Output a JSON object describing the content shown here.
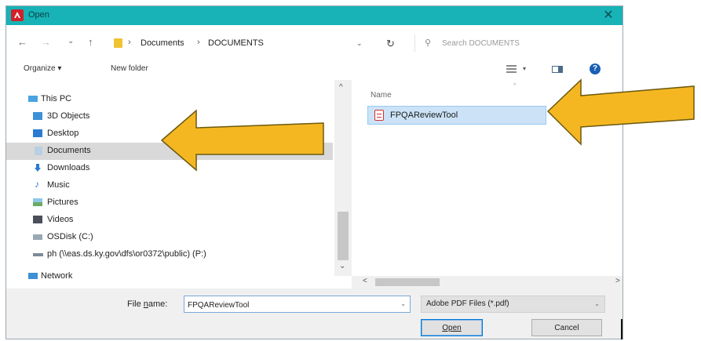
{
  "colors": {
    "titlebar": "#17b3b7",
    "accent": "#d0212a",
    "arrow_fill": "#f5b721",
    "arrow_stroke": "#6b5a10",
    "selection": "#cce3f7"
  },
  "window": {
    "title": "Open",
    "app_icon": "acrobat-icon",
    "close_glyph": "✕"
  },
  "navbar": {
    "back_glyph": "←",
    "forward_glyph": "→",
    "recent_glyph": "⌄",
    "up_glyph": "↑",
    "breadcrumb": [
      "Documents",
      "DOCUMENTS"
    ],
    "breadcrumb_prefix": "›",
    "breadcrumb_sep": "›",
    "dropdown_glyph": "⌄",
    "refresh_glyph": "↻",
    "search_placeholder": "Search DOCUMENTS"
  },
  "toolbar": {
    "organize_label": "Organize ▾",
    "new_folder_label": "New folder",
    "help_glyph": "?"
  },
  "sidebar": {
    "items": [
      {
        "label": "This PC",
        "icon": "this-pc-icon"
      },
      {
        "label": "3D Objects",
        "icon": "3d-objects-icon"
      },
      {
        "label": "Desktop",
        "icon": "desktop-icon"
      },
      {
        "label": "Documents",
        "icon": "documents-icon",
        "selected": true
      },
      {
        "label": "Downloads",
        "icon": "downloads-icon"
      },
      {
        "label": "Music",
        "icon": "music-icon"
      },
      {
        "label": "Pictures",
        "icon": "pictures-icon"
      },
      {
        "label": "Videos",
        "icon": "videos-icon"
      },
      {
        "label": "OSDisk (C:)",
        "icon": "drive-icon"
      },
      {
        "label": "ph (\\\\eas.ds.ky.gov\\dfs\\or0372\\public) (P:)",
        "icon": "network-drive-icon"
      },
      {
        "label": "Network",
        "icon": "network-icon"
      }
    ],
    "scroll_up_glyph": "^",
    "scroll_down_glyph": "⌄"
  },
  "files": {
    "column_header": "Name",
    "sort_glyph": "^",
    "items": [
      {
        "name": "FPQAReviewTool",
        "icon": "pdf-file-icon"
      }
    ],
    "scroll_left_glyph": "<",
    "scroll_right_glyph": ">"
  },
  "footer": {
    "filename_label": "File name:",
    "filename_value": "FPQAReviewTool",
    "filename_caret": "⌄",
    "filetype_value": "Adobe PDF Files (*.pdf)",
    "filetype_caret": "⌄",
    "open_label": "Open",
    "cancel_label": "Cancel"
  }
}
